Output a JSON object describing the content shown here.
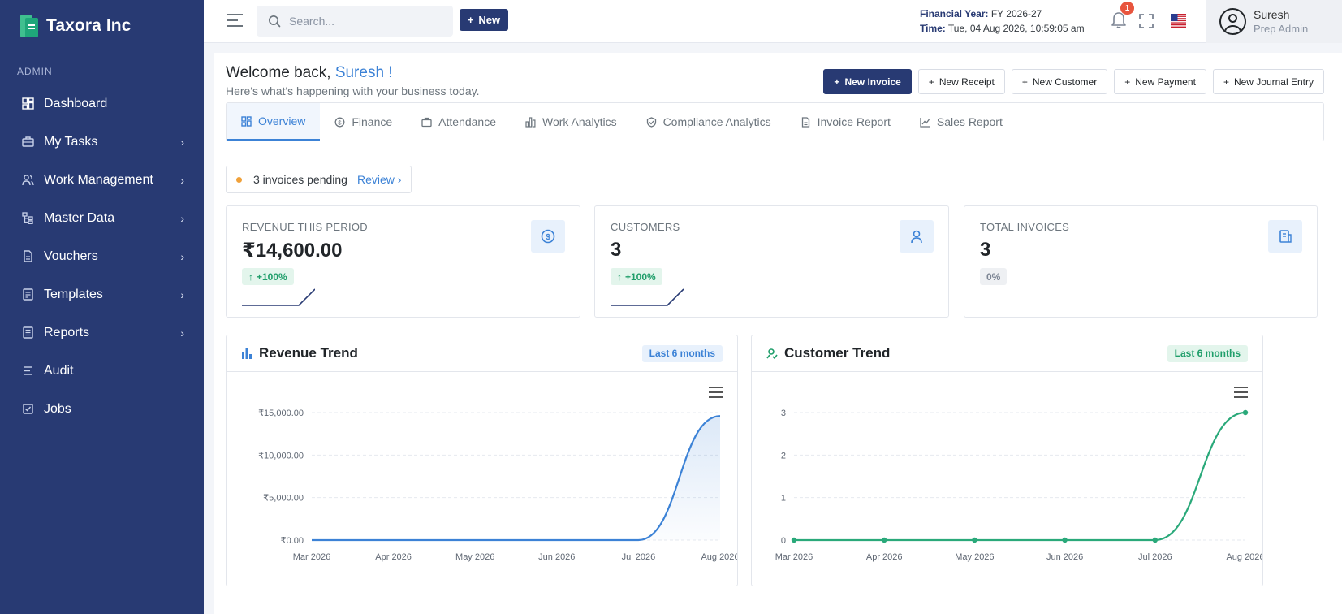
{
  "brand": {
    "name": "Taxora Inc"
  },
  "sidebar": {
    "section": "ADMIN",
    "items": [
      {
        "label": "Dashboard",
        "icon": "dashboard-icon",
        "has_children": false
      },
      {
        "label": "My Tasks",
        "icon": "briefcase-icon",
        "has_children": true
      },
      {
        "label": "Work Management",
        "icon": "users-icon",
        "has_children": true
      },
      {
        "label": "Master Data",
        "icon": "hierarchy-icon",
        "has_children": true
      },
      {
        "label": "Vouchers",
        "icon": "document-icon",
        "has_children": true
      },
      {
        "label": "Templates",
        "icon": "template-icon",
        "has_children": true
      },
      {
        "label": "Reports",
        "icon": "report-icon",
        "has_children": true
      },
      {
        "label": "Audit",
        "icon": "list-icon",
        "has_children": false
      },
      {
        "label": "Jobs",
        "icon": "checkbox-icon",
        "has_children": false
      }
    ]
  },
  "topbar": {
    "search_placeholder": "Search...",
    "new_label": "New",
    "financial_year_label": "Financial Year:",
    "financial_year_value": "FY 2026-27",
    "time_label": "Time:",
    "time_value": "Tue, 04 Aug 2026, 10:59:05 am",
    "notification_count": "1",
    "user_name": "Suresh",
    "user_role": "Prep Admin"
  },
  "welcome": {
    "greeting": "Welcome back,",
    "name": "Suresh !",
    "subtitle": "Here's what's happening with your business today."
  },
  "actions": [
    {
      "label": "New Invoice",
      "primary": true
    },
    {
      "label": "New Receipt",
      "primary": false
    },
    {
      "label": "New Customer",
      "primary": false
    },
    {
      "label": "New Payment",
      "primary": false
    },
    {
      "label": "New Journal Entry",
      "primary": false
    }
  ],
  "tabs": [
    {
      "label": "Overview",
      "active": true
    },
    {
      "label": "Finance",
      "active": false
    },
    {
      "label": "Attendance",
      "active": false
    },
    {
      "label": "Work Analytics",
      "active": false
    },
    {
      "label": "Compliance Analytics",
      "active": false
    },
    {
      "label": "Invoice Report",
      "active": false
    },
    {
      "label": "Sales Report",
      "active": false
    }
  ],
  "pending": {
    "text": "3 invoices pending",
    "link": "Review ›"
  },
  "kpis": [
    {
      "title": "REVENUE THIS PERIOD",
      "value": "₹14,600.00",
      "badge": "+100%",
      "trend": "up"
    },
    {
      "title": "CUSTOMERS",
      "value": "3",
      "badge": "+100%",
      "trend": "up"
    },
    {
      "title": "TOTAL INVOICES",
      "value": "3",
      "badge": "0%",
      "trend": "flat"
    }
  ],
  "revenue_card": {
    "title": "Revenue Trend",
    "pill": "Last 6 months"
  },
  "customer_card": {
    "title": "Customer Trend",
    "pill": "Last 6 months"
  },
  "colors": {
    "sidebar": "#283a73",
    "accent": "#3c82d6",
    "green": "#1f9e6a"
  },
  "chart_data": [
    {
      "type": "area",
      "title": "Revenue Trend",
      "categories": [
        "Mar 2026",
        "Apr 2026",
        "May 2026",
        "Jun 2026",
        "Jul 2026",
        "Aug 2026"
      ],
      "series": [
        {
          "values": [
            0,
            0,
            0,
            0,
            0,
            14600
          ]
        }
      ],
      "y_ticks": [
        "₹0.00",
        "₹5,000.00",
        "₹10,000.00",
        "₹15,000.00"
      ],
      "ylim": [
        0,
        15000
      ],
      "grid": true
    },
    {
      "type": "line",
      "title": "Customer Trend",
      "categories": [
        "Mar 2026",
        "Apr 2026",
        "May 2026",
        "Jun 2026",
        "Jul 2026",
        "Aug 2026"
      ],
      "series": [
        {
          "values": [
            0,
            0,
            0,
            0,
            0,
            3
          ]
        }
      ],
      "y_ticks": [
        "0",
        "1",
        "2",
        "3"
      ],
      "ylim": [
        0,
        3
      ],
      "grid": true
    }
  ]
}
